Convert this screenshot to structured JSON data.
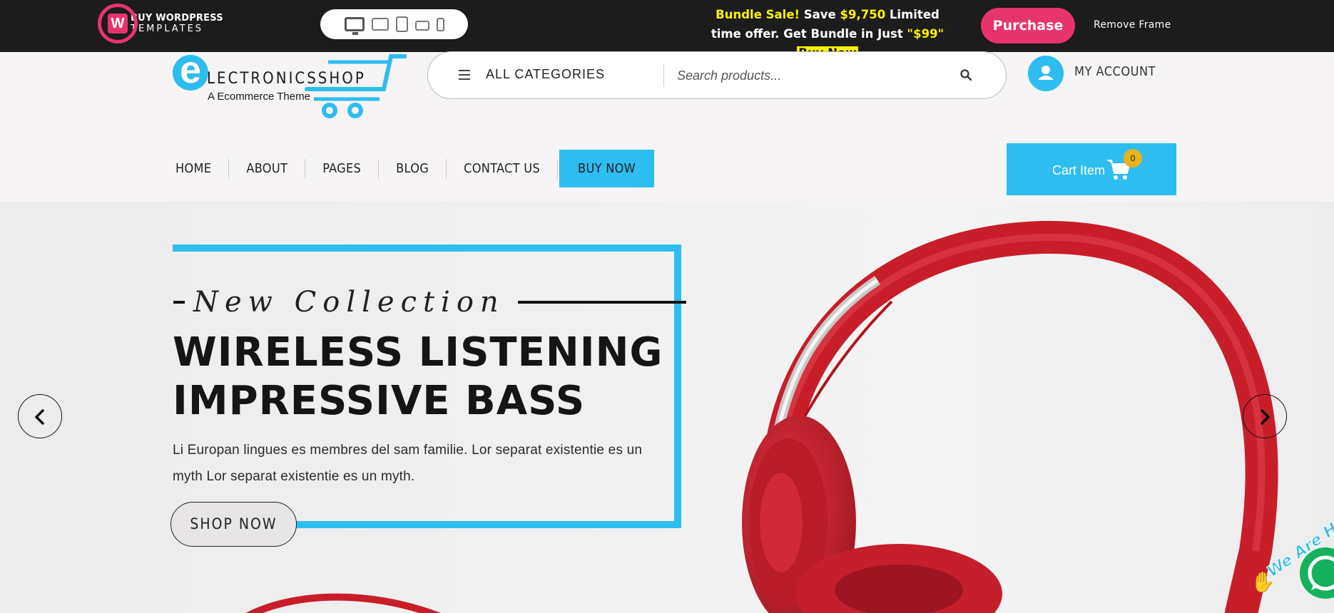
{
  "topbar": {
    "brand_line1": "BUY WORDPRESS",
    "brand_line2": "TEMPLATES",
    "devices": [
      "desktop-icon",
      "laptop-icon",
      "tablet-icon",
      "tablet-landscape-icon",
      "phone-icon"
    ],
    "promo_part1": "Bundle Sale!",
    "promo_part2": " Save ",
    "promo_part3": "$9,750",
    "promo_part4": " Limited time offer. Get Bundle in Just ",
    "promo_part5": "\"$99\"",
    "promo_cta": "Buy Now",
    "purchase_label": "Purchase",
    "remove_frame_label": "Remove Frame"
  },
  "header": {
    "logo_letter": "e",
    "logo_name": "LECTRONICSSHOP",
    "logo_tagline": "A Ecommerce Theme",
    "categories_label": "ALL CATEGORIES",
    "search_placeholder": "Search products...",
    "account_label": "MY ACCOUNT"
  },
  "nav": {
    "items": [
      {
        "label": "HOME"
      },
      {
        "label": "ABOUT"
      },
      {
        "label": "PAGES"
      },
      {
        "label": "BLOG"
      },
      {
        "label": "CONTACT US"
      },
      {
        "label": "BUY NOW"
      }
    ]
  },
  "cart": {
    "label": "Cart Item",
    "count": "0"
  },
  "hero": {
    "subtitle": "New Collection",
    "title_line1": "WIRELESS LISTENING",
    "title_line2": "IMPRESSIVE BASS",
    "description": "Li Europan lingues es membres del sam familie. Lor separat existentie es un myth Lor separat existentie es un myth.",
    "cta_label": "SHOP NOW"
  },
  "chat": {
    "text": "We Are Here"
  },
  "colors": {
    "accent": "#2ebdf0",
    "brand_pink": "#e8336c",
    "promo_yellow": "#fff200",
    "topbar_bg": "#1c1c1c",
    "chat_green": "#14b25c",
    "headphone_red": "#d21f2c"
  }
}
